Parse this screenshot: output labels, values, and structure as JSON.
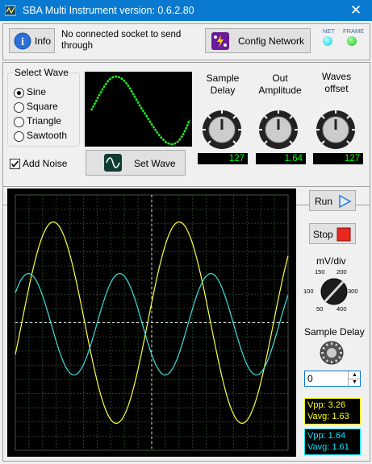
{
  "window": {
    "title": "SBA Multi Instrument version: 0.6.2.80",
    "close_glyph": "✕"
  },
  "toolbar": {
    "info_label": "Info",
    "status_text": "No connected socket to send through",
    "config_label": "Config Network",
    "net_label": "NET",
    "frame_label": "FRAME",
    "net_color": "#00e5ff",
    "frame_color": "#22dd22"
  },
  "wave": {
    "group_label": "Select Wave",
    "options": [
      "Sine",
      "Square",
      "Triangle",
      "Sawtooth"
    ],
    "selected": "Sine",
    "add_noise_label": "Add Noise",
    "add_noise_checked": true,
    "set_wave_label": "Set Wave"
  },
  "knobs": [
    {
      "label": "Sample Delay",
      "value": "127"
    },
    {
      "label": "Out Amplitude",
      "value": "1.64"
    },
    {
      "label": "Waves offset",
      "value": "127"
    }
  ],
  "scope": {
    "run_label": "Run",
    "stop_label": "Stop",
    "mv_div_label": "mV/div",
    "mv_div_options": [
      "150",
      "200",
      "100",
      "300",
      "50",
      "400"
    ],
    "sample_delay_label": "Sample Delay",
    "sample_delay_value": "0",
    "yellow_vpp": "Vpp: 3.26",
    "yellow_vavg": "Vavg: 1.63",
    "cyan_vpp": "Vpp: 1.64",
    "cyan_vavg": "Vavg: 1.61",
    "trace1_color": "#ffff40",
    "trace2_color": "#40e0e0"
  }
}
